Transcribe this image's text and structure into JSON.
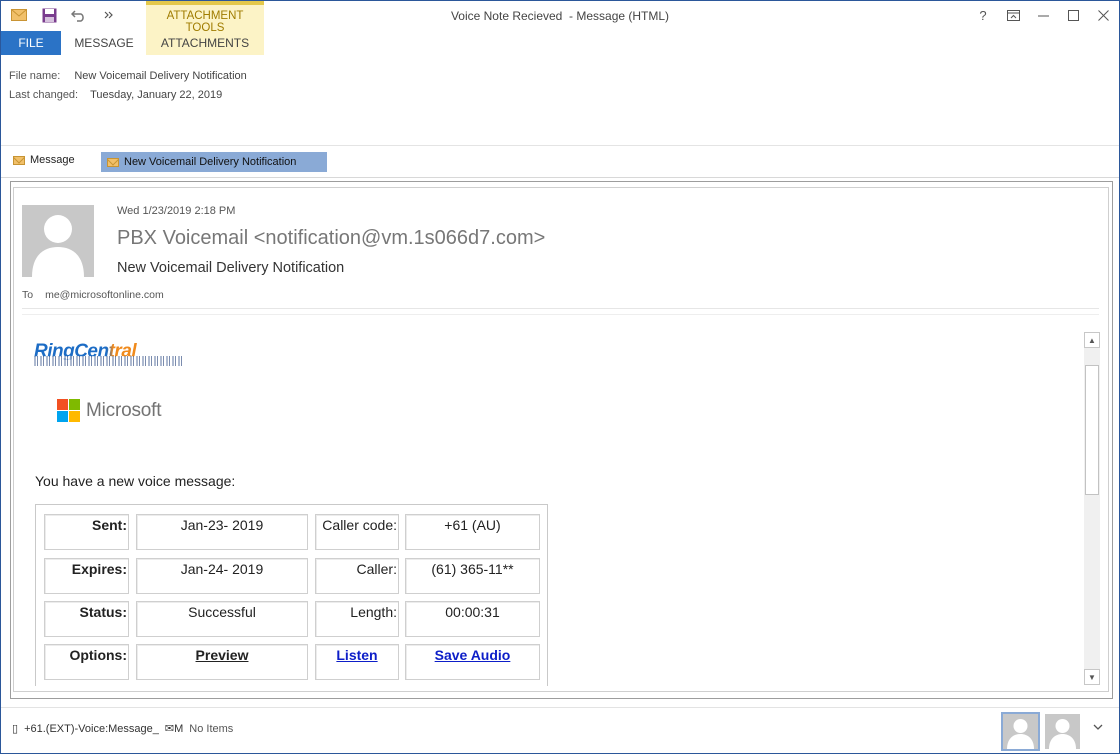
{
  "window": {
    "title": "Voice Note Recieved  - Message (HTML)",
    "contextual_group": "ATTACHMENT TOOLS",
    "controls": {
      "help": "?",
      "restore_ribbon": "⧉",
      "minimize": "—",
      "maximize": "☐",
      "close": "✕"
    }
  },
  "tabs": {
    "file": "FILE",
    "message": "MESSAGE",
    "attachments": "ATTACHMENTS"
  },
  "file_info": {
    "file_name_label": "File name:",
    "file_name": "New Voicemail Delivery Notification",
    "last_changed_label": "Last changed:",
    "last_changed": "Tuesday, January 22, 2019"
  },
  "attachment_bar": {
    "message_item": "Message",
    "selected_item": "New Voicemail Delivery Notification"
  },
  "email": {
    "date": "Wed 1/23/2019 2:18 PM",
    "from": "PBX Voicemail <notification@vm.1s066d7.com>",
    "subject": "New Voicemail Delivery Notification",
    "to_label": "To",
    "to": "me@microsoftonline.com"
  },
  "body": {
    "ringcentral_logo": "RingCentral",
    "microsoft_logo": "Microsoft",
    "intro": "You have a new voice message:",
    "rows": [
      {
        "l1": "Sent:",
        "v1": "Jan-23- 2019",
        "l2": "Caller code:",
        "v2": "+61 (AU)"
      },
      {
        "l1": "Expires:",
        "v1": "Jan-24- 2019",
        "l2": "Caller:",
        "v2": "(61) 365-11**"
      },
      {
        "l1": "Status:",
        "v1": "Successful",
        "l2": "Length:",
        "v2": "00:00:31"
      },
      {
        "l1": "Options:",
        "v1": "Preview",
        "l2": "Listen",
        "v2": "Save Audio"
      }
    ]
  },
  "status_bar": {
    "group": "+61.(EXT)-Voice:Message_",
    "separator": "✉M",
    "people": "No Items"
  },
  "colors": {
    "accent": "#2b73c6",
    "ribbon_context": "#fcf3c6",
    "selection": "#8aaad6",
    "link": "#0d1ec8"
  }
}
